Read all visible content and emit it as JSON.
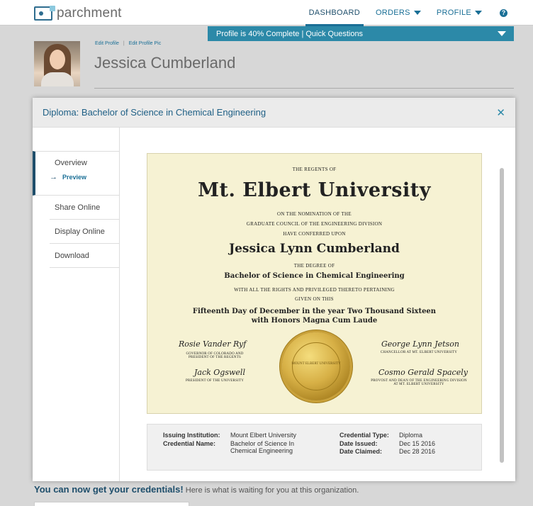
{
  "topbar": {
    "logo_text": "parchment",
    "nav": {
      "dashboard": "DASHBOARD",
      "orders": "ORDERS",
      "profile": "PROFILE",
      "help_glyph": "?"
    }
  },
  "profile_bar": {
    "text": "Profile is 40% Complete | Quick Questions",
    "completion_percent": 40
  },
  "header": {
    "edit_profile": "Edit Profile",
    "separator": "|",
    "edit_profile_pic": "Edit Profile Pic",
    "name": "Jessica Cumberland"
  },
  "modal": {
    "title": "Diploma: Bachelor of Science in Chemical Engineering",
    "close_glyph": "✕",
    "sidebar": {
      "overview": "Overview",
      "preview": "Preview",
      "share_online": "Share Online",
      "display_online": "Display Online",
      "download": "Download"
    },
    "diploma": {
      "regents": "THE REGENTS OF",
      "university": "Mt. Elbert University",
      "line1": "ON THE NOMINATION OF THE",
      "line2": "GRADUATE COUNCIL OF THE ENGINEERING DIVISION",
      "line3": "HAVE CONFERRED UPON",
      "recipient": "Jessica Lynn Cumberland",
      "degree_of": "THE DEGREE OF",
      "degree": "Bachelor of Science in Chemical Engineering",
      "rights": "WITH ALL THE RIGHTS AND PRIVILEGED THERETO PERTAINING",
      "given": "GIVEN ON THIS",
      "date_line": "Fifteenth Day of December in the year Two Thousand Sixteen",
      "honors": "with Honors Magna Cum Laude",
      "sig1_name": "Rosie Vander Ryf",
      "sig1_role1": "GOVERNOR OF COLORADO AND",
      "sig1_role2": "PRESIDENT OF THE REGENTS",
      "sig2_name": "Jack Ogswell",
      "sig2_role": "PRESIDENT OF THE UNIVERSITY",
      "sig3_name": "George Lynn Jetson",
      "sig3_role": "CHANCELLOR AT MT. ELBERT UNIVERSITY",
      "sig4_name": "Cosmo Gerald Spacely",
      "sig4_role1": "PROVOST AND DEAN OF THE ENGINEERING DIVISION",
      "sig4_role2": "AT MT. ELBERT UNIVERSITY",
      "seal_text": "MOUNT ELBERT UNIVERSITY"
    },
    "details": {
      "issuing_label": "Issuing Institution:",
      "issuing_value": "Mount Elbert University",
      "credential_name_label": "Credential Name:",
      "credential_name_value1": "Bachelor of Science In",
      "credential_name_value2": "Chemical Engineering",
      "type_label": "Credential Type:",
      "type_value": "Diploma",
      "issued_label": "Date Issued:",
      "issued_value": "Dec 15 2016",
      "claimed_label": "Date Claimed:",
      "claimed_value": "Dec 28 2016"
    }
  },
  "bottom": {
    "headline": "You can now get your credentials!",
    "subtext": " Here is what is waiting for you at this organization."
  },
  "colors": {
    "accent": "#1a6f96",
    "profile_bar": "#2c89a8",
    "diploma_bg": "#f6f2d3"
  }
}
